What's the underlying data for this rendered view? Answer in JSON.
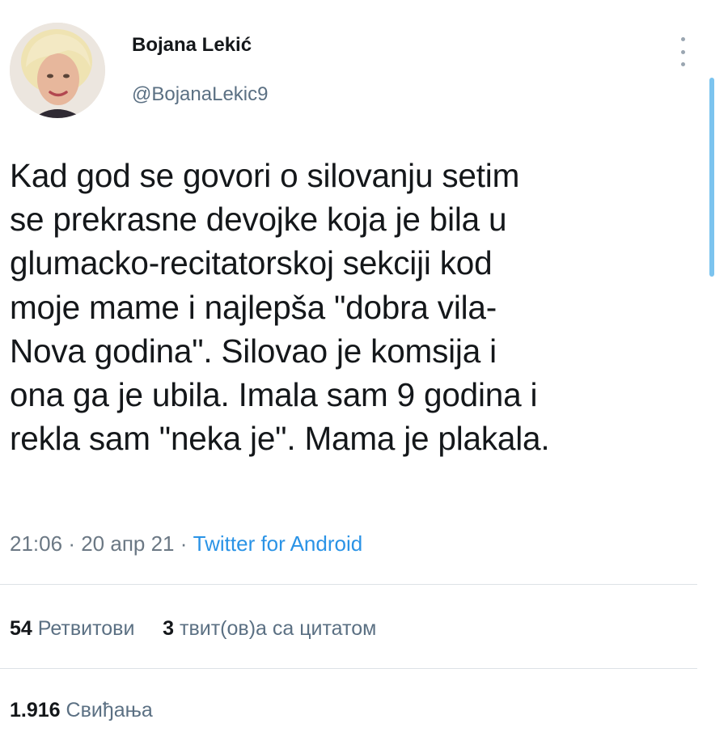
{
  "author": {
    "display_name": "Bojana Lekić",
    "handle": "@BojanaLekic9"
  },
  "tweet": {
    "lines": [
      "Kad god se govori o silovanju setim",
      "se prekrasne devojke koja je bila u",
      "glumacko-recitatorskoj sekciji kod",
      "moje mame i najlepša \"dobra vila-",
      "Nova godina\". Silovao je komsija i",
      "ona ga je ubila. Imala sam 9 godina i",
      "rekla sam \"neka je\". Mama je plakala."
    ]
  },
  "meta": {
    "time": "21:06",
    "date": "20 апр 21",
    "separator": "·",
    "source": "Twitter for Android"
  },
  "stats": {
    "retweets_count": "54",
    "retweets_label": "Ретвитови",
    "quotes_count": "3",
    "quotes_label": "твит(ов)а са цитатом",
    "likes_count": "1.916",
    "likes_label": "Свиђања"
  },
  "icons": {
    "more": "more-vertical-icon"
  },
  "colors": {
    "link": "#2a93e6",
    "secondary_text": "#5b7083",
    "scrollbar": "#7cc4ef"
  }
}
